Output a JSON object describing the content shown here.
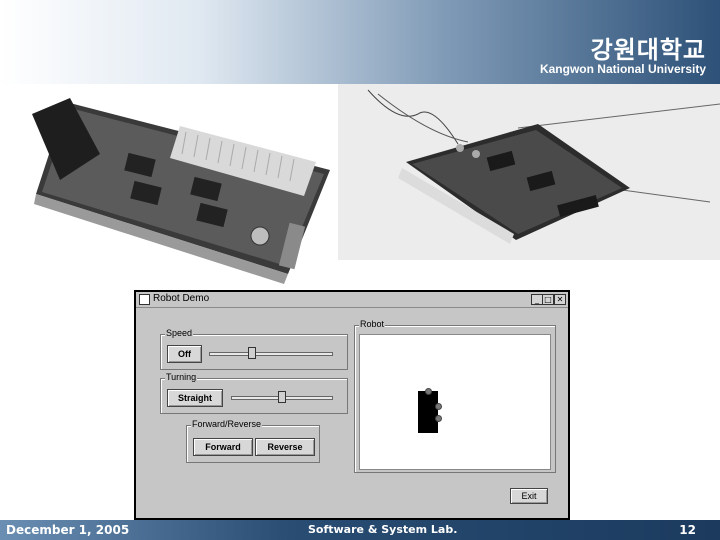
{
  "header": {
    "university_ko": "강원대학교",
    "university_en": "Kangwon National University",
    "gradient_colors": [
      "#ffffff",
      "#7f9ab6",
      "#2d5178"
    ]
  },
  "photos": {
    "left": "robot-controller-board-photo",
    "right": "robot-sensor-board-photo"
  },
  "window": {
    "title": "Robot Demo",
    "controls": {
      "minimize": "_",
      "maximize": "□",
      "close": "✕"
    },
    "speed_group": {
      "label": "Speed",
      "button_label": "Off",
      "slider_value": 0.35
    },
    "turning_group": {
      "label": "Turning",
      "button_label": "Straight",
      "slider_value": 0.5
    },
    "direction_group": {
      "label": "Forward/Reverse",
      "forward_label": "Forward",
      "reverse_label": "Reverse"
    },
    "robot_group": {
      "label": "Robot"
    },
    "exit_label": "Exit"
  },
  "footer": {
    "date": "December 1, 2005",
    "lab": "Software & System Lab.",
    "page_number": "12"
  }
}
